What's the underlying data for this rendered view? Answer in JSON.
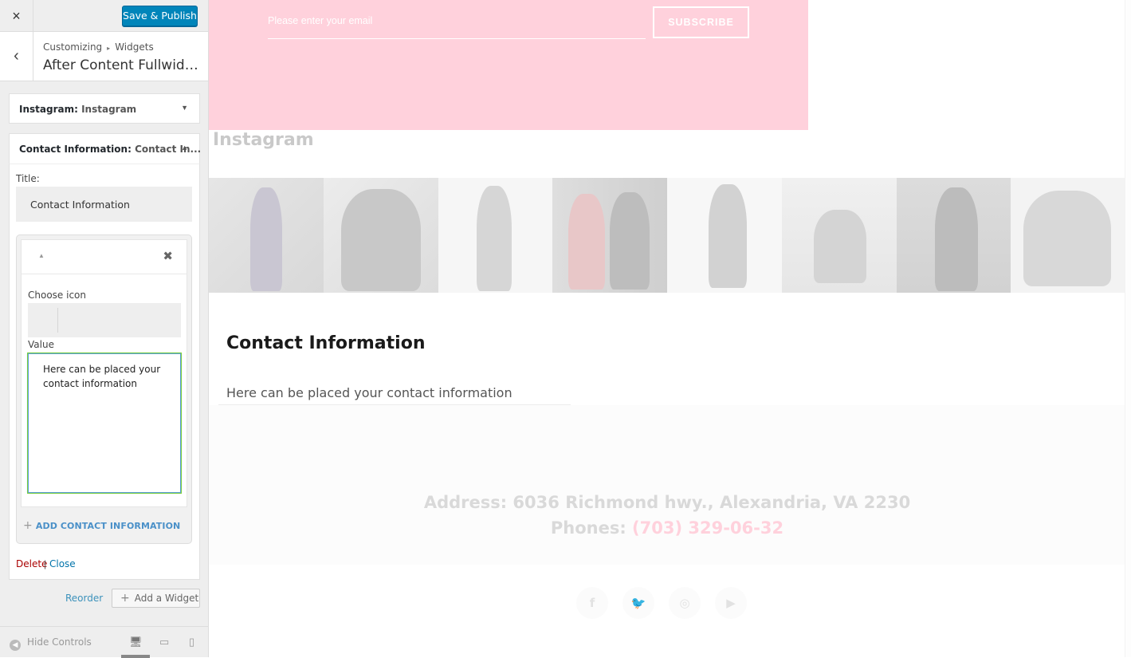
{
  "topbar": {
    "close_icon": "×",
    "save_label": "Save & Publish"
  },
  "section": {
    "back_icon": "‹",
    "crumb_first": "Customizing",
    "crumb_sep": "▸",
    "crumb_second": "Widgets",
    "title": "After Content Fullwidth ..."
  },
  "widgets": {
    "instagram": {
      "name": "Instagram:",
      "sub": "Instagram",
      "arrow": "▼"
    },
    "contact": {
      "name": "Contact Information:",
      "sub": "Contact In...",
      "arrow": "▲"
    }
  },
  "form": {
    "title_label": "Title:",
    "title_value": "Contact Information",
    "choose_icon_label": "Choose icon",
    "value_label": "Value",
    "value_text": "Here can be placed your contact information",
    "add_contact": "ADD CONTACT INFORMATION",
    "delete": "Delete",
    "pipe": "|",
    "close": "Close",
    "reorder": "Reorder",
    "add_widget": "Add a Widget"
  },
  "footer": {
    "hide_controls": "Hide Controls"
  },
  "preview": {
    "email_placeholder": "Please enter your email",
    "subscribe": "SUBSCRIBE",
    "instagram_title": "Instagram",
    "contact_title": "Contact Information",
    "contact_text": "Here can be placed your contact information",
    "address": "Address: 6036 Richmond hwy., Alexandria, VA 2230",
    "phones_label": "Phones:",
    "phones_number": "(703) 329-06-32",
    "social_icons": [
      "facebook-icon",
      "twitter-icon",
      "instagram-icon",
      "youtube-icon"
    ]
  },
  "colors": {
    "accent": "#0085ba",
    "pink": "#ffd1dc",
    "link": "#0073aa",
    "delete": "#aa0000"
  }
}
